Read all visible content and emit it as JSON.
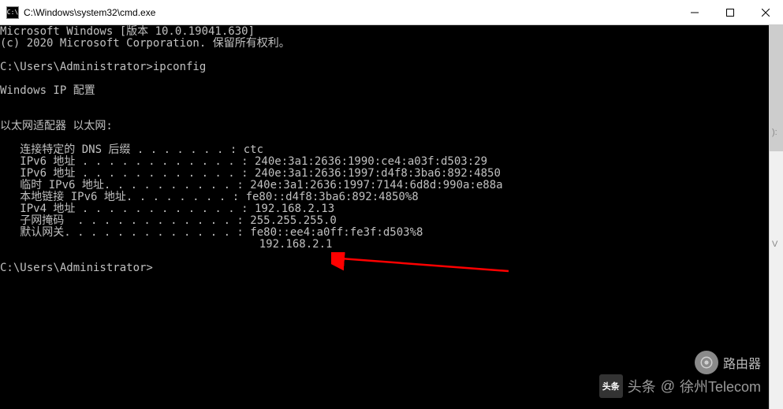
{
  "titlebar": {
    "icon_label": "C:\\",
    "title": "C:\\Windows\\system32\\cmd.exe"
  },
  "window_controls": {
    "minimize": "minimize",
    "maximize": "maximize",
    "close": "close"
  },
  "terminal": {
    "line01": "Microsoft Windows [版本 10.0.19041.630]",
    "line02": "(c) 2020 Microsoft Corporation. 保留所有权利。",
    "line03": "",
    "line04": "C:\\Users\\Administrator>ipconfig",
    "line05": "",
    "line06": "Windows IP 配置",
    "line07": "",
    "line08": "",
    "line09": "以太网适配器 以太网:",
    "line10": "",
    "line11": "   连接特定的 DNS 后缀 . . . . . . . : ctc",
    "line12": "   IPv6 地址 . . . . . . . . . . . . : 240e:3a1:2636:1990:ce4:a03f:d503:29",
    "line13": "   IPv6 地址 . . . . . . . . . . . . : 240e:3a1:2636:1997:d4f8:3ba6:892:4850",
    "line14": "   临时 IPv6 地址. . . . . . . . . . : 240e:3a1:2636:1997:7144:6d8d:990a:e88a",
    "line15": "   本地链接 IPv6 地址. . . . . . . . : fe80::d4f8:3ba6:892:4850%8",
    "line16": "   IPv4 地址 . . . . . . . . . . . . : 192.168.2.13",
    "line17": "   子网掩码  . . . . . . . . . . . . : 255.255.255.0",
    "line18": "   默认网关. . . . . . . . . . . . . : fe80::ee4:a0ff:fe3f:d503%8",
    "line19": "                                       192.168.2.1",
    "line20": "",
    "line21": "C:\\Users\\Administrator>"
  },
  "watermark": {
    "prefix": "头条",
    "at": "@",
    "name": "徐州Telecom"
  },
  "router_badge": {
    "label": "路由器"
  }
}
